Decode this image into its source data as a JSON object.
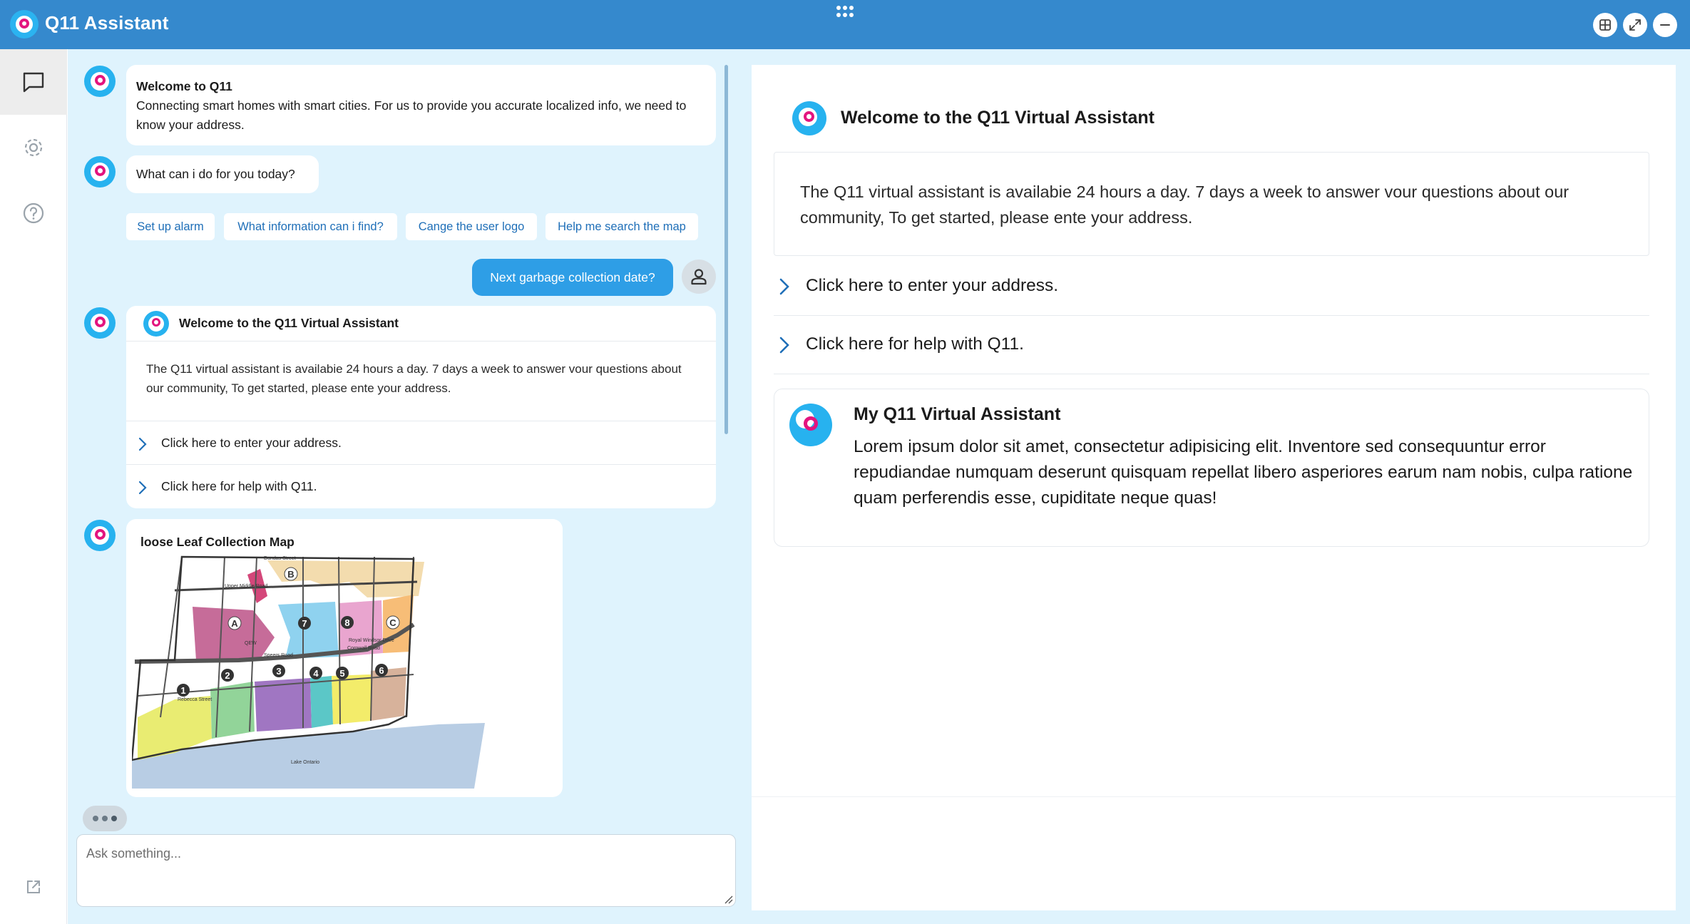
{
  "app": {
    "title": "Q11 Assistant"
  },
  "window_controls": [
    "layout-icon",
    "expand-icon",
    "minimize-icon"
  ],
  "sidebar": {
    "items": [
      "chat-icon",
      "settings-icon",
      "help-icon"
    ],
    "footer": "external-link-icon"
  },
  "chat": {
    "welcome": {
      "title": "Welcome to Q11",
      "text": "Connecting smart homes with smart cities. For us to provide you accurate localized info, we need to know your address."
    },
    "question": "What can i do for you today?",
    "suggestions": [
      "Set up alarm",
      "What information can i find?",
      "Cange the user logo",
      "Help me search the map"
    ],
    "user_message": "Next garbage collection date?",
    "card": {
      "title": "Welcome to the Q11 Virtual Assistant",
      "body": "The Q11 virtual assistant is availabie 24 hours a day. 7 days a week to answer vour questions about our community, To get started, please ente your address.",
      "rows": [
        "Click here to enter your address.",
        "Click here for help with Q11."
      ]
    },
    "map": {
      "title": "loose Leaf Collection Map",
      "streets": [
        "Dundas Street",
        "Upper Middle Road",
        "Speers Road",
        "Rebecca Street",
        "Cornwall Road",
        "Royal Windsor Drive",
        "Lake Ontario",
        "QEW"
      ],
      "zones": [
        "A",
        "B",
        "C",
        "1",
        "2",
        "3",
        "4",
        "5",
        "6",
        "7",
        "8"
      ]
    },
    "input": {
      "placeholder": "Ask something..."
    }
  },
  "panel": {
    "title": "Welcome to the Q11 Virtual Assistant",
    "text": "The Q11 virtual assistant is availabie 24 hours a day. 7 days a week to answer vour questions about our community, To get started, please ente your address.",
    "rows": [
      "Click here to enter your address.",
      "Click here for help with Q11."
    ],
    "assistant_card": {
      "title": "My Q11 Virtual Assistant",
      "text": "Lorem ipsum dolor sit amet, consectetur adipisicing elit. Inventore sed consequuntur error repudiandae numquam deserunt quisquam repellat libero asperiores earum nam nobis, culpa ratione quam perferendis esse, cupiditate neque quas!"
    }
  },
  "colors": {
    "header": "#3589cd",
    "chat_bg": "#dff3fd",
    "accent": "#2e9ee6",
    "link": "#1f6fb8",
    "brand_pink": "#e3157f"
  }
}
